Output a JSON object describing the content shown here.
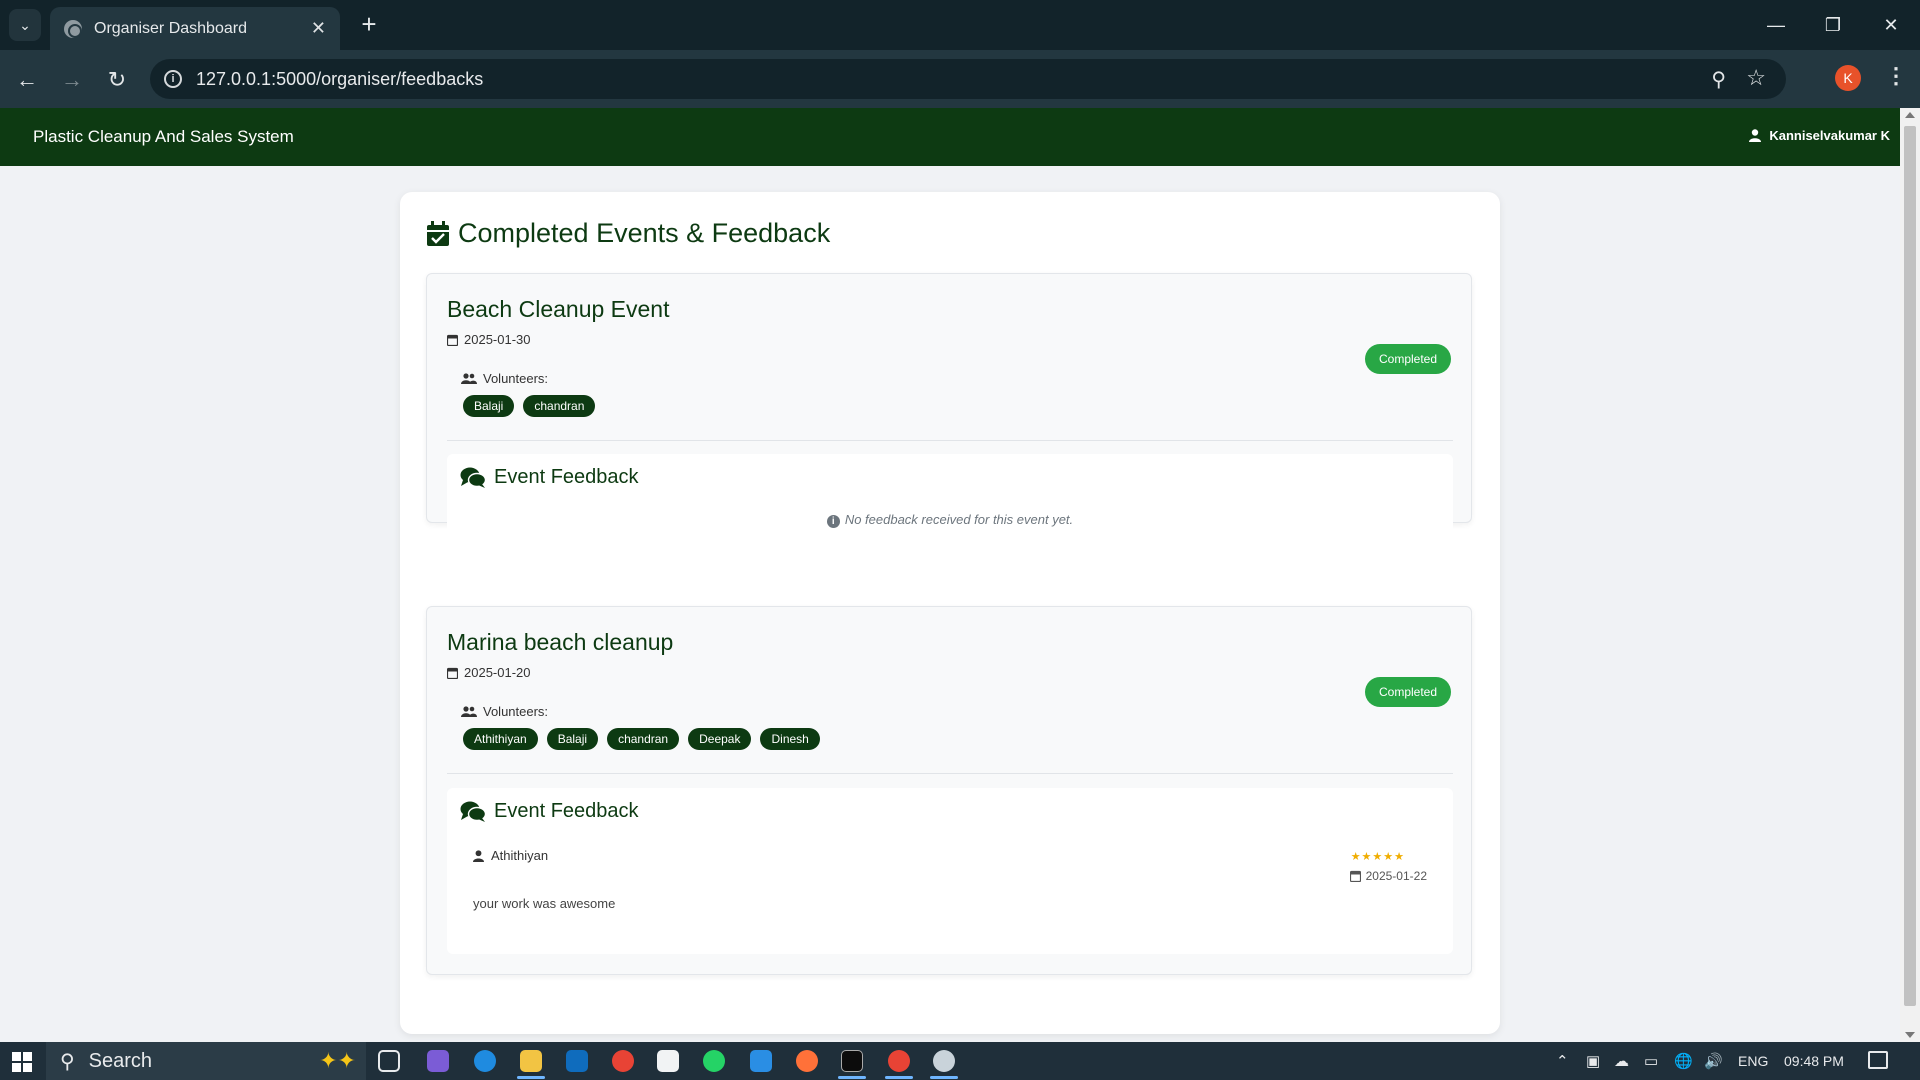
{
  "browser": {
    "tab_title": "Organiser Dashboard",
    "url": "127.0.0.1:5000/organiser/feedbacks",
    "profile_initial": "K"
  },
  "navbar": {
    "brand": "Plastic Cleanup And Sales System",
    "user_name": "Kanniselvakumar K"
  },
  "page": {
    "title": "Completed Events & Feedback"
  },
  "events": [
    {
      "name": "Beach Cleanup Event",
      "date": "2025-01-30",
      "volunteers_label": "Volunteers:",
      "volunteers": [
        "Balaji",
        "chandran"
      ],
      "status": "Completed",
      "feedback_title": "Event Feedback",
      "no_feedback_text": "No feedback received for this event yet."
    },
    {
      "name": "Marina beach cleanup",
      "date": "2025-01-20",
      "volunteers_label": "Volunteers:",
      "volunteers": [
        "Athithiyan",
        "Balaji",
        "chandran",
        "Deepak",
        "Dinesh"
      ],
      "status": "Completed",
      "feedback_title": "Event Feedback",
      "feedback": [
        {
          "author": "Athithiyan",
          "rating": 5,
          "stars": "★★★★★",
          "date": "2025-01-22",
          "text": "your work was awesome"
        }
      ]
    }
  ],
  "taskbar": {
    "search_label": "Search",
    "language": "ENG",
    "time": "09:48 PM"
  },
  "colors": {
    "navbar": "#0d3a12",
    "accent": "#0d3a12",
    "status_completed": "#28a745",
    "star": "#f0ad00"
  }
}
